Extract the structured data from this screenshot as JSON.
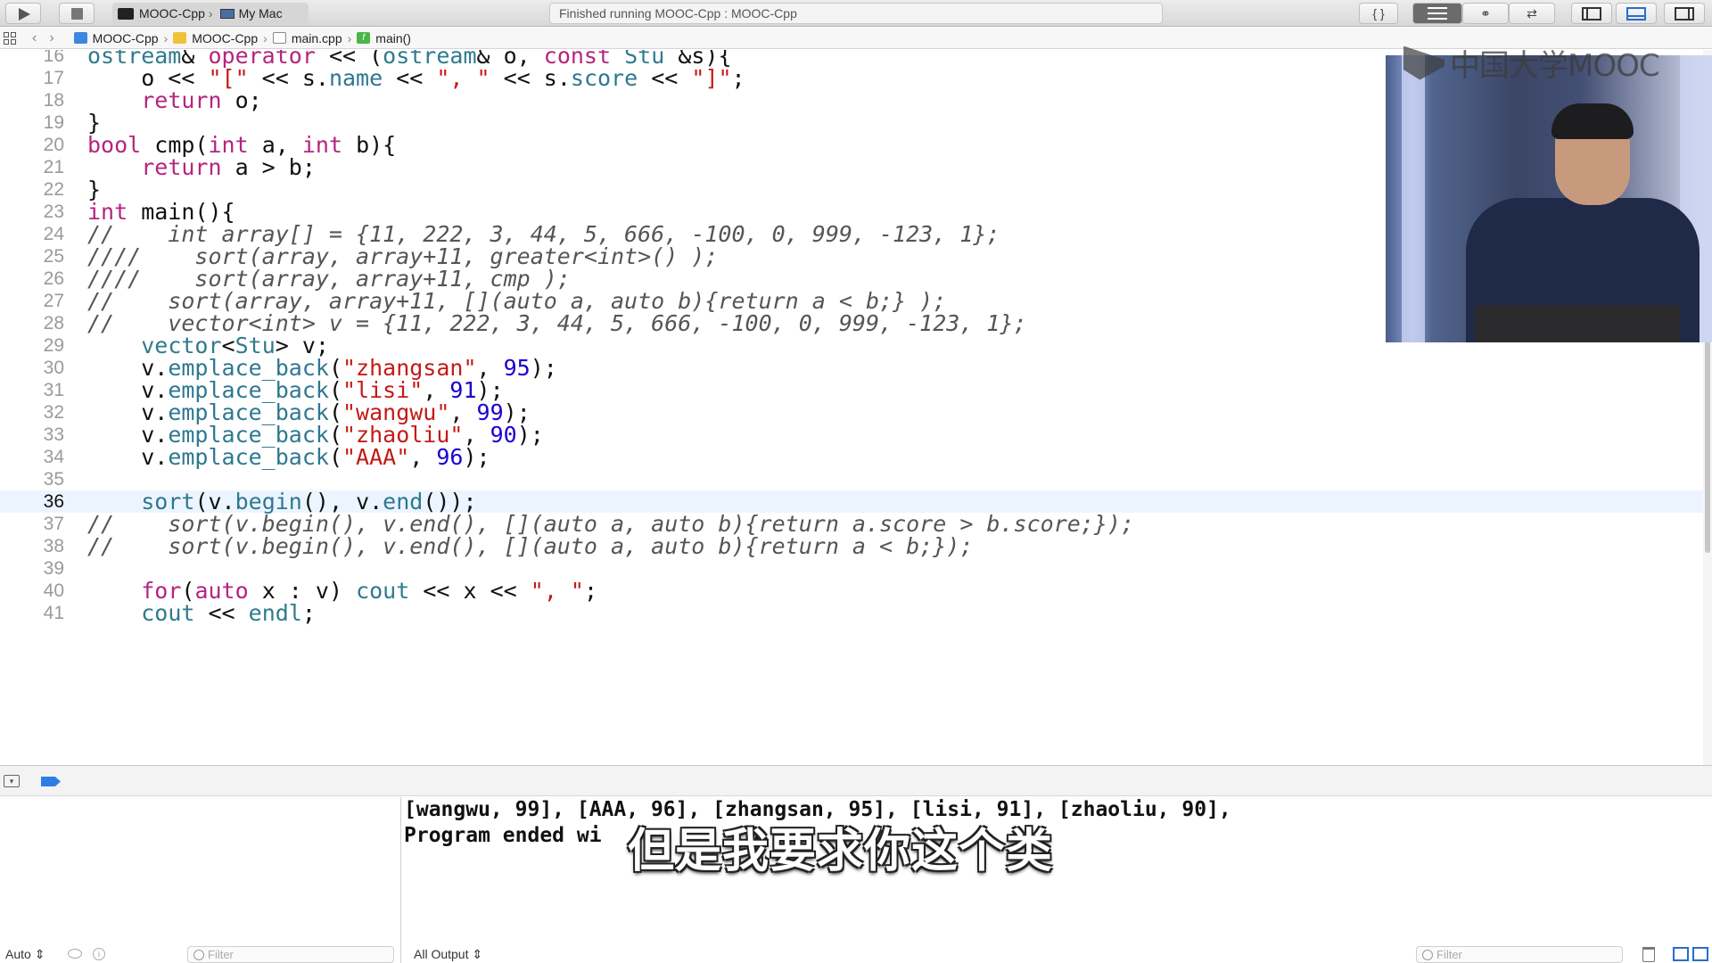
{
  "toolbar": {
    "scheme": "MOOC-Cpp",
    "destination": "My Mac",
    "activity_status": "Finished running MOOC-Cpp : MOOC-Cpp",
    "braces_label": "{ }",
    "editor_version_label": "⇄",
    "editor_assistant_label": "⚭"
  },
  "jumpbar": {
    "crumbs": [
      "MOOC-Cpp",
      "MOOC-Cpp",
      "main.cpp",
      "main()"
    ],
    "function_icon_label": "f"
  },
  "editor": {
    "current_line": 36,
    "lines": [
      {
        "n": "16",
        "tokens": [
          [
            "t-ty",
            "ostream"
          ],
          [
            "",
            "& "
          ],
          [
            "t-kw",
            "operator"
          ],
          [
            "",
            " << ("
          ],
          [
            "t-ty",
            "ostream"
          ],
          [
            "",
            "& o, "
          ],
          [
            "t-kw",
            "const"
          ],
          [
            "",
            " "
          ],
          [
            "t-ty",
            "Stu"
          ],
          [
            "",
            " &s){"
          ]
        ]
      },
      {
        "n": "17",
        "tokens": [
          [
            "",
            "    o << "
          ],
          [
            "t-st",
            "\"[\""
          ],
          [
            "",
            " << s."
          ],
          [
            "t-me",
            "name"
          ],
          [
            "",
            " << "
          ],
          [
            "t-st",
            "\", \""
          ],
          [
            "",
            " << s."
          ],
          [
            "t-me",
            "score"
          ],
          [
            "",
            " << "
          ],
          [
            "t-st",
            "\"]\""
          ],
          [
            "",
            ";"
          ]
        ]
      },
      {
        "n": "18",
        "tokens": [
          [
            "",
            "    "
          ],
          [
            "t-kw",
            "return"
          ],
          [
            "",
            " o;"
          ]
        ]
      },
      {
        "n": "19",
        "tokens": [
          [
            "",
            "}"
          ]
        ]
      },
      {
        "n": "20",
        "tokens": [
          [
            "t-kw",
            "bool"
          ],
          [
            "",
            " cmp("
          ],
          [
            "t-kw",
            "int"
          ],
          [
            "",
            " a, "
          ],
          [
            "t-kw",
            "int"
          ],
          [
            "",
            " b){"
          ]
        ]
      },
      {
        "n": "21",
        "tokens": [
          [
            "",
            "    "
          ],
          [
            "t-kw",
            "return"
          ],
          [
            "",
            " a > b;"
          ]
        ]
      },
      {
        "n": "22",
        "tokens": [
          [
            "",
            "}"
          ]
        ]
      },
      {
        "n": "23",
        "tokens": [
          [
            "t-kw",
            "int"
          ],
          [
            "",
            " main(){"
          ]
        ]
      },
      {
        "n": "24",
        "tokens": [
          [
            "t-co",
            "//    int array[] = {11, 222, 3, 44, 5, 666, -100, 0, 999, -123, 1};"
          ]
        ]
      },
      {
        "n": "25",
        "tokens": [
          [
            "t-co",
            "////    sort(array, array+11, greater<int>() );"
          ]
        ]
      },
      {
        "n": "26",
        "tokens": [
          [
            "t-co",
            "////    sort(array, array+11, cmp );"
          ]
        ]
      },
      {
        "n": "27",
        "tokens": [
          [
            "t-co",
            "//    sort(array, array+11, [](auto a, auto b){return a < b;} );"
          ]
        ]
      },
      {
        "n": "28",
        "tokens": [
          [
            "t-co",
            "//    vector<int> v = {11, 222, 3, 44, 5, 666, -100, 0, 999, -123, 1};"
          ]
        ]
      },
      {
        "n": "29",
        "tokens": [
          [
            "",
            "    "
          ],
          [
            "t-ty",
            "vector"
          ],
          [
            "",
            "<"
          ],
          [
            "t-ty",
            "Stu"
          ],
          [
            "",
            "> v;"
          ]
        ]
      },
      {
        "n": "30",
        "tokens": [
          [
            "",
            "    v."
          ],
          [
            "t-me",
            "emplace_back"
          ],
          [
            "",
            "("
          ],
          [
            "t-st",
            "\"zhangsan\""
          ],
          [
            "",
            ", "
          ],
          [
            "t-nu",
            "95"
          ],
          [
            "",
            ");"
          ]
        ]
      },
      {
        "n": "31",
        "tokens": [
          [
            "",
            "    v."
          ],
          [
            "t-me",
            "emplace_back"
          ],
          [
            "",
            "("
          ],
          [
            "t-st",
            "\"lisi\""
          ],
          [
            "",
            ", "
          ],
          [
            "t-nu",
            "91"
          ],
          [
            "",
            ");"
          ]
        ]
      },
      {
        "n": "32",
        "tokens": [
          [
            "",
            "    v."
          ],
          [
            "t-me",
            "emplace_back"
          ],
          [
            "",
            "("
          ],
          [
            "t-st",
            "\"wangwu\""
          ],
          [
            "",
            ", "
          ],
          [
            "t-nu",
            "99"
          ],
          [
            "",
            ");"
          ]
        ]
      },
      {
        "n": "33",
        "tokens": [
          [
            "",
            "    v."
          ],
          [
            "t-me",
            "emplace_back"
          ],
          [
            "",
            "("
          ],
          [
            "t-st",
            "\"zhaoliu\""
          ],
          [
            "",
            ", "
          ],
          [
            "t-nu",
            "90"
          ],
          [
            "",
            ");"
          ]
        ]
      },
      {
        "n": "34",
        "tokens": [
          [
            "",
            "    v."
          ],
          [
            "t-me",
            "emplace_back"
          ],
          [
            "",
            "("
          ],
          [
            "t-st",
            "\"AAA\""
          ],
          [
            "",
            ", "
          ],
          [
            "t-nu",
            "96"
          ],
          [
            "",
            ");"
          ]
        ]
      },
      {
        "n": "35",
        "tokens": [
          [
            "",
            ""
          ]
        ]
      },
      {
        "n": "36",
        "tokens": [
          [
            "",
            "    "
          ],
          [
            "t-me",
            "sort"
          ],
          [
            "",
            "(v."
          ],
          [
            "t-me",
            "begin"
          ],
          [
            "",
            "(), v."
          ],
          [
            "t-me",
            "end"
          ],
          [
            "",
            "());"
          ]
        ]
      },
      {
        "n": "37",
        "tokens": [
          [
            "t-co",
            "//    sort(v.begin(), v.end(), [](auto a, auto b){return a.score > b.score;});"
          ]
        ]
      },
      {
        "n": "38",
        "tokens": [
          [
            "t-co",
            "//    sort(v.begin(), v.end(), [](auto a, auto b){return a < b;});"
          ]
        ]
      },
      {
        "n": "39",
        "tokens": [
          [
            "",
            ""
          ]
        ]
      },
      {
        "n": "40",
        "tokens": [
          [
            "",
            "    "
          ],
          [
            "t-kw",
            "for"
          ],
          [
            "",
            "("
          ],
          [
            "t-kw",
            "auto"
          ],
          [
            "",
            " x : v) "
          ],
          [
            "t-ty",
            "cout"
          ],
          [
            "",
            " << x << "
          ],
          [
            "t-st",
            "\", \""
          ],
          [
            "",
            ";"
          ]
        ]
      },
      {
        "n": "41",
        "tokens": [
          [
            "",
            "    "
          ],
          [
            "t-ty",
            "cout"
          ],
          [
            "",
            " << "
          ],
          [
            "t-ty",
            "endl"
          ],
          [
            "",
            ";"
          ]
        ]
      }
    ]
  },
  "video": {
    "logo_text": "中国大学MOOC"
  },
  "console": {
    "output_line_1": "[wangwu, 99], [AAA, 96], [zhangsan, 95], [lisi, 91], [zhaoliu, 90],",
    "output_line_2": "Program ended wi",
    "output_line_2_tail": "e",
    "output_line_2_end": "0",
    "subtitle": "但是我要求你这个类"
  },
  "bottom": {
    "auto_select": "Auto ⇕",
    "vars_filter_placeholder": "Filter",
    "output_select": "All Output ⇕",
    "console_filter_placeholder": "Filter"
  },
  "colors": {
    "keyword": "#b5247f",
    "type": "#2f7b8c",
    "string": "#c41a16",
    "number": "#1c00cf",
    "current_line": "#ecf5ff",
    "accent": "#2a6bd1"
  }
}
